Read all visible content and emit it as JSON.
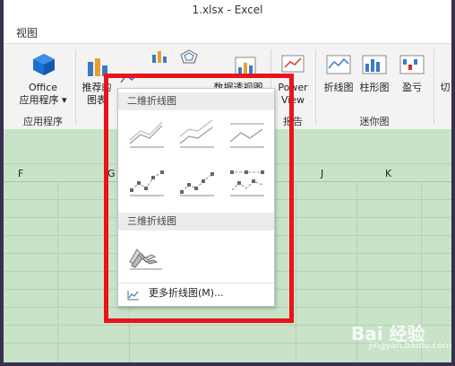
{
  "window": {
    "title": "1.xlsx - Excel"
  },
  "menu": {
    "tab_view": "视图"
  },
  "ribbon": {
    "office_apps": {
      "line1": "Office",
      "line2": "应用程序 ▾"
    },
    "group_apps": "应用程序",
    "recommended": {
      "line1": "推荐的",
      "line2": "图表"
    },
    "pivot_chart": "数据透视图",
    "power_view": {
      "line1": "Power",
      "line2": "View"
    },
    "group_report": "报告",
    "sparkline_line": "折线图",
    "sparkline_column": "柱形图",
    "sparkline_winloss": "盈亏",
    "group_sparklines": "迷你图",
    "slicer_partial": "切"
  },
  "columns": [
    "F",
    "G",
    "J",
    "K"
  ],
  "dropdown": {
    "section_2d": "二维折线图",
    "section_3d": "三维折线图",
    "more_label": "更多折线图(M)..."
  },
  "colors": {
    "accent_red": "#e8141c",
    "sheet_green": "#c9e3c8",
    "ribbon_bg": "#f3f3f3"
  },
  "watermark": {
    "main": "Bai 经验",
    "sub": "jingyan.baidu.com"
  }
}
